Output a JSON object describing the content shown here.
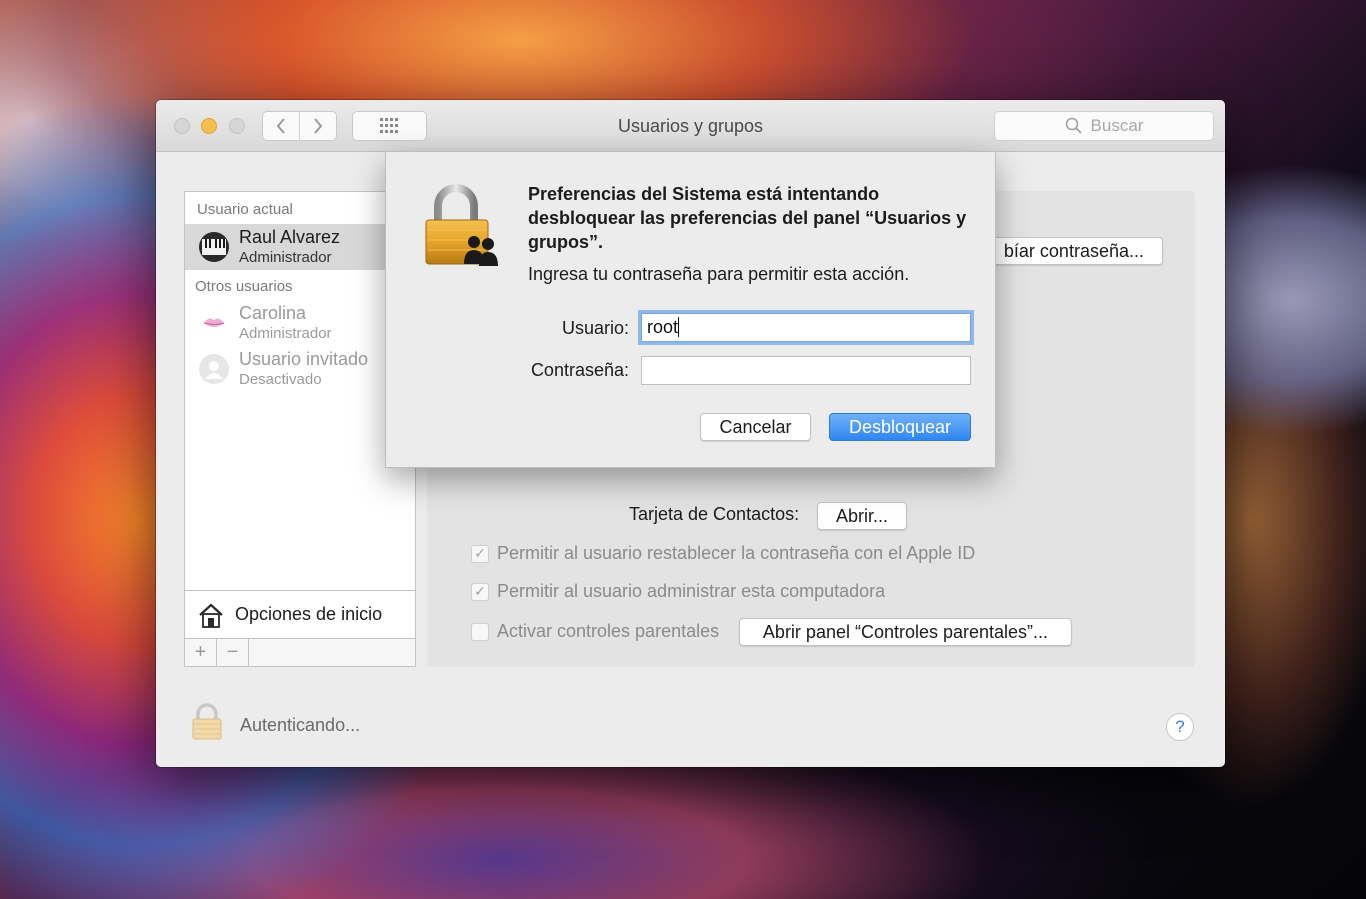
{
  "window": {
    "title": "Usuarios y grupos",
    "search_placeholder": "Buscar"
  },
  "sidebar": {
    "current_user_section": "Usuario actual",
    "current_user": {
      "name": "Raul Alvarez",
      "role": "Administrador"
    },
    "other_users_section": "Otros usuarios",
    "other_users": [
      {
        "name": "Carolina",
        "role": "Administrador"
      },
      {
        "name": "Usuario invitado",
        "role": "Desactivado"
      }
    ],
    "login_options": "Opciones de inicio",
    "add_label": "+",
    "remove_label": "−"
  },
  "panel": {
    "change_password_button": "bíar contraseña...",
    "contact_card_label": "Tarjeta de Contactos:",
    "open_button": "Abrir...",
    "checkboxes": [
      {
        "label": "Permitir al usuario restablecer la contraseña con el Apple ID",
        "checked": true
      },
      {
        "label": "Permitir al usuario administrar esta computadora",
        "checked": true
      },
      {
        "label": "Activar controles parentales",
        "checked": false
      }
    ],
    "parental_button": "Abrir panel “Controles parentales”..."
  },
  "bottom": {
    "status": "Autenticando...",
    "help": "?"
  },
  "dialog": {
    "title": "Preferencias del Sistema está intentando desbloquear las preferencias del panel “Usuarios y grupos”.",
    "subtitle": "Ingresa tu contraseña para permitir esta acción.",
    "username_label": "Usuario:",
    "username_value": "root",
    "password_label": "Contraseña:",
    "password_value": "",
    "cancel_button": "Cancelar",
    "unlock_button": "Desbloquear"
  },
  "colors": {
    "accent": "#2f86f0",
    "window_bg": "#ececec",
    "minimize_yellow": "#f5bf4f"
  }
}
